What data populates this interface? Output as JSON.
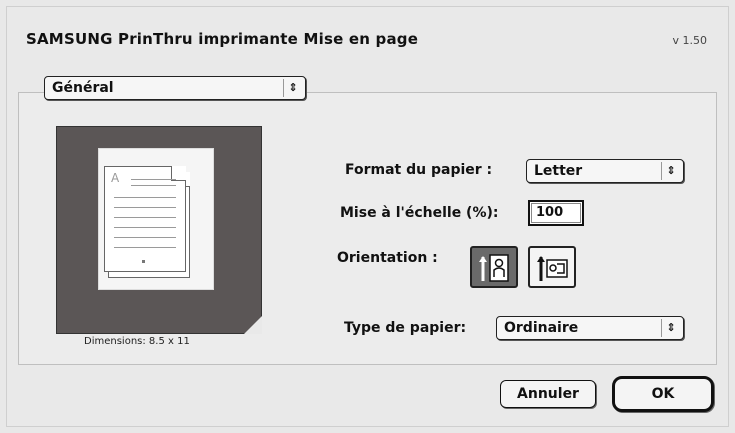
{
  "window": {
    "title": "SAMSUNG PrinThru imprimante Mise en page",
    "version": "v 1.50"
  },
  "panel_popup": {
    "value": "Général",
    "arrow": "⇕"
  },
  "preview": {
    "dimensions": "Dimensions: 8.5 x 11",
    "page_letter": "A"
  },
  "paper_format": {
    "label": "Format du papier :",
    "value": "Letter"
  },
  "scale": {
    "label": "Mise à l'échelle (%):",
    "value": "100"
  },
  "orientation": {
    "label": "Orientation :",
    "options": [
      "portrait-icon",
      "landscape-icon"
    ],
    "selected": "portrait-icon"
  },
  "paper_type": {
    "label": "Type de papier:",
    "value": "Ordinaire"
  },
  "buttons": {
    "cancel": "Annuler",
    "ok": "OK"
  }
}
